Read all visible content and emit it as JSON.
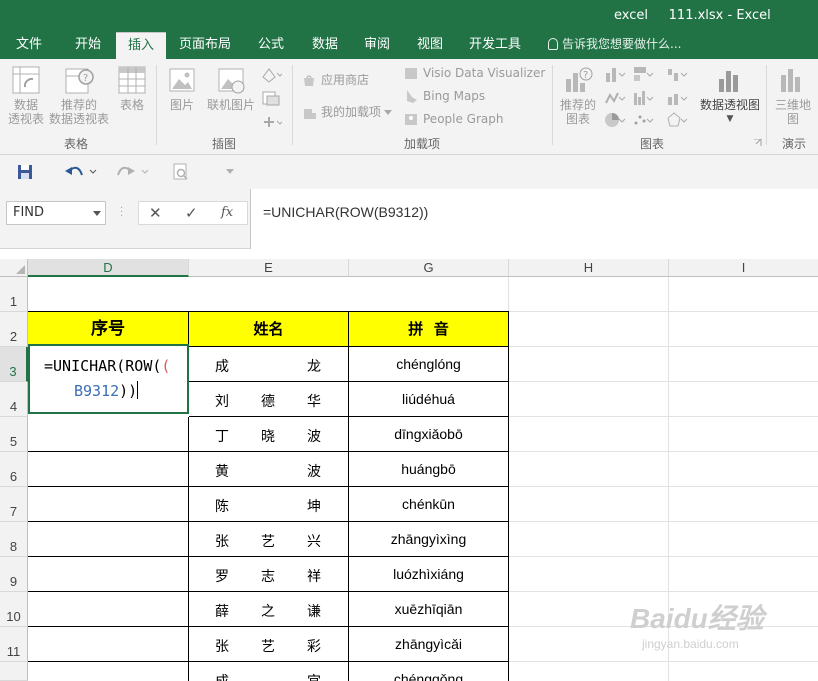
{
  "titlebar": {
    "title": "excel     111.xlsx - Excel"
  },
  "tabs": [
    {
      "label": "文件",
      "active": false
    },
    {
      "label": "开始",
      "active": false
    },
    {
      "label": "插入",
      "active": true
    },
    {
      "label": "页面布局",
      "active": false
    },
    {
      "label": "公式",
      "active": false
    },
    {
      "label": "数据",
      "active": false
    },
    {
      "label": "审阅",
      "active": false
    },
    {
      "label": "视图",
      "active": false
    },
    {
      "label": "开发工具",
      "active": false
    }
  ],
  "tellme": "告诉我您想要做什么...",
  "ribbon": {
    "tables": {
      "pivot_line1": "数据",
      "pivot_line2": "透视表",
      "rec_pivot_line1": "推荐的",
      "rec_pivot_line2": "数据透视表",
      "table": "表格",
      "group": "表格"
    },
    "illustrations": {
      "picture": "图片",
      "online_picture": "联机图片",
      "group": "插图"
    },
    "addins": {
      "store": "应用商店",
      "my_addins": "我的加载项",
      "visio": "Visio Data Visualizer",
      "bing": "Bing Maps",
      "people": "People Graph",
      "group": "加载项"
    },
    "charts": {
      "rec_charts_line1": "推荐的",
      "rec_charts_line2": "图表",
      "pivot_chart": "数据透视图",
      "group": "图表"
    },
    "tours": {
      "map3d_line1": "三维地",
      "map3d_line2": "图",
      "group": "演示"
    }
  },
  "namebox": "FIND",
  "formula": "=UNICHAR(ROW(B9312))",
  "edit": {
    "part1": "=UNICHAR(ROW(",
    "paren": "(",
    "ref": "B9312",
    "close": "))"
  },
  "columns": [
    "D",
    "E",
    "G",
    "H",
    "I"
  ],
  "rows": [
    "1",
    "2",
    "3",
    "4",
    "5",
    "6",
    "7",
    "8",
    "9",
    "10",
    "11"
  ],
  "headers": {
    "seq": "序号",
    "name": "姓名",
    "pinyin": "拼  音"
  },
  "names": [
    [
      "成",
      "",
      "龙"
    ],
    [
      "刘",
      "德",
      "华"
    ],
    [
      "丁",
      "晓",
      "波"
    ],
    [
      "黄",
      "",
      "波"
    ],
    [
      "陈",
      "",
      "坤"
    ],
    [
      "张",
      "艺",
      "兴"
    ],
    [
      "罗",
      "志",
      "祥"
    ],
    [
      "薛",
      "之",
      "谦"
    ],
    [
      "张",
      "艺",
      "彩"
    ],
    [
      "成",
      "",
      "宫"
    ]
  ],
  "pinyin": [
    "chénglóng",
    "liúdéhuá",
    "dīngxiǎobō",
    "huángbō",
    "chénkūn",
    "zhāngyìxìng",
    "luózhìxiáng",
    "xuēzhīqiān",
    "zhāngyìcǎi",
    "chénggǒng"
  ],
  "watermark": {
    "big": "Baidu经验",
    "small": "jingyan.baidu.com"
  },
  "colors": {
    "excel_green": "#217346",
    "header_yellow": "#ffff00"
  }
}
